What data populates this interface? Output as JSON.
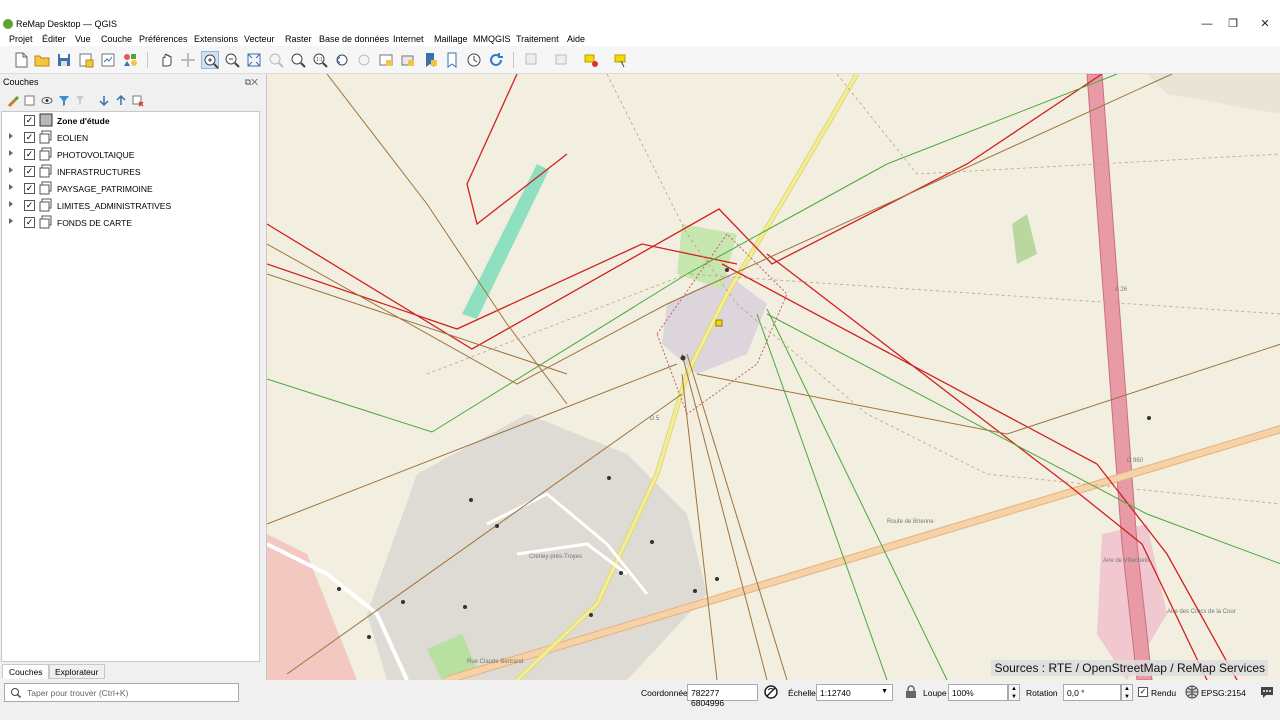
{
  "window": {
    "title": "ReMap Desktop — QGIS",
    "controls": {
      "minimize": "—",
      "maximize": "❐",
      "close": "✕"
    }
  },
  "menubar": {
    "items": [
      "Projet",
      "Éditer",
      "Vue",
      "Couche",
      "Préférences",
      "Extensions",
      "Vecteur",
      "Raster",
      "Base de données",
      "Internet",
      "Maillage",
      "MMQGIS",
      "Traitement",
      "Aide"
    ]
  },
  "layers_panel": {
    "title": "Couches",
    "controls": "⧉✕",
    "layers": [
      {
        "name": "Zone d'étude",
        "checked": true,
        "bold": true,
        "expandable": false
      },
      {
        "name": "EOLIEN",
        "checked": true,
        "bold": false,
        "expandable": true
      },
      {
        "name": "PHOTOVOLTAIQUE",
        "checked": true,
        "bold": false,
        "expandable": true
      },
      {
        "name": "INFRASTRUCTURES",
        "checked": true,
        "bold": false,
        "expandable": true
      },
      {
        "name": "PAYSAGE_PATRIMOINE",
        "checked": true,
        "bold": false,
        "expandable": true
      },
      {
        "name": "LIMITES_ADMINISTRATIVES",
        "checked": true,
        "bold": false,
        "expandable": true
      },
      {
        "name": "FONDS DE CARTE",
        "checked": true,
        "bold": false,
        "expandable": true
      }
    ],
    "check_mark": "✓"
  },
  "panel_tabs": [
    "Couches",
    "Explorateur"
  ],
  "search": {
    "placeholder": "Taper pour trouver (Ctrl+K)"
  },
  "statusbar": {
    "coordinate_label": "Coordonnée",
    "coordinate_value": "782277 6804996",
    "scale_label": "Échelle",
    "scale_value": "1:12740",
    "magnifier_label": "Loupe",
    "magnifier_value": "100%",
    "rotation_label": "Rotation",
    "rotation_value": "0,0 °",
    "render_label": "Rendu",
    "render_checked": true,
    "crs": "EPSG:2154"
  },
  "map": {
    "attribution": "Sources : RTE / OpenStreetMap / ReMap Services",
    "labels": {
      "a26": "A 26",
      "d960": "D 960",
      "d5": "D 5",
      "town": "Creney-près-Troyes",
      "route_brienne": "Route de Brienne",
      "rue_claude": "Rue Claude Bertrand",
      "aire_villechetif": "Aire de Villechetif",
      "aire_cour": "Aire des Crocs de la Cour"
    }
  },
  "colors": {
    "map_background": "#f2efe1",
    "line_red": "#d22020",
    "line_green": "#4aa83a",
    "line_brown": "#a0723a",
    "motorway": "#e89aa6",
    "primary_road": "#f2c38f",
    "secondary_road": "#f3ed9a",
    "urban": "#dedbd5",
    "park": "#c8e6b0",
    "water_like": "#8fe0c0",
    "selection_yellow": "#f5d800"
  }
}
